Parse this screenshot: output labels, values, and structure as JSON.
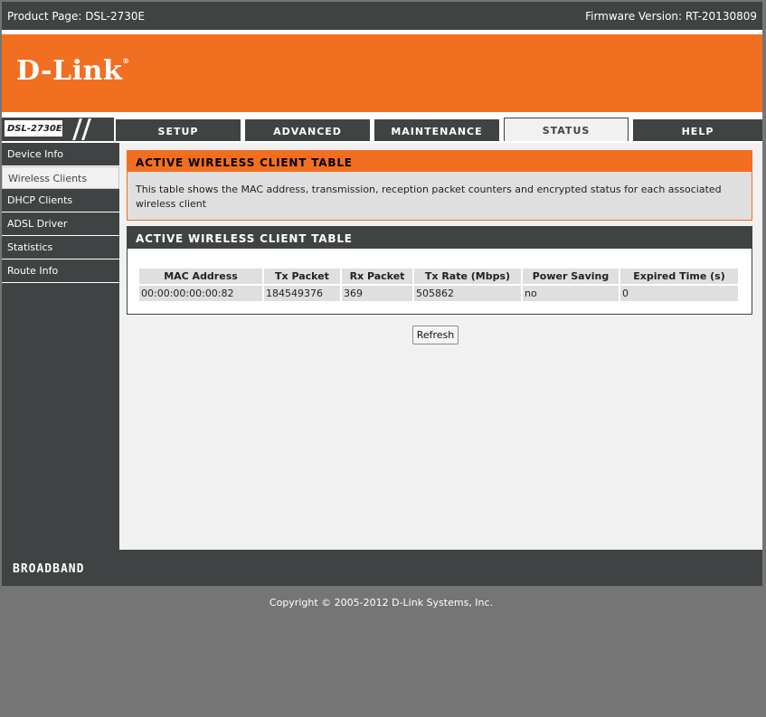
{
  "topbar": {
    "product": "Product Page: DSL-2730E",
    "firmware": "Firmware Version: RT-20130809"
  },
  "brand": {
    "logo": "D-Link",
    "reg": "®",
    "model": "DSL-2730E",
    "accent": "#f26f21",
    "dark": "#404343"
  },
  "tabs": [
    {
      "label": "SETUP",
      "active": false
    },
    {
      "label": "ADVANCED",
      "active": false
    },
    {
      "label": "MAINTENANCE",
      "active": false
    },
    {
      "label": "STATUS",
      "active": true
    },
    {
      "label": "HELP",
      "active": false
    }
  ],
  "sidebar": {
    "items": [
      {
        "label": "Device Info",
        "active": false
      },
      {
        "label": "Wireless Clients",
        "active": true
      },
      {
        "label": "DHCP Clients",
        "active": false
      },
      {
        "label": "ADSL Driver",
        "active": false
      },
      {
        "label": "Statistics",
        "active": false
      },
      {
        "label": "Route Info",
        "active": false
      }
    ]
  },
  "info_box": {
    "title": "ACTIVE WIRELESS CLIENT TABLE",
    "description": "This table shows the MAC address, transmission, reception packet counters and encrypted status for each associated wireless client"
  },
  "client_table": {
    "title": "ACTIVE WIRELESS CLIENT TABLE",
    "columns": [
      "MAC Address",
      "Tx Packet",
      "Rx Packet",
      "Tx Rate (Mbps)",
      "Power Saving",
      "Expired Time (s)"
    ],
    "rows": [
      [
        "00:00:00:00:00:82",
        "184549376",
        "369",
        "505862",
        "no",
        "0"
      ]
    ]
  },
  "refresh_label": "Refresh",
  "footer": {
    "text": "BROADBAND"
  },
  "copyright": "Copyright © 2005-2012 D-Link Systems, Inc."
}
